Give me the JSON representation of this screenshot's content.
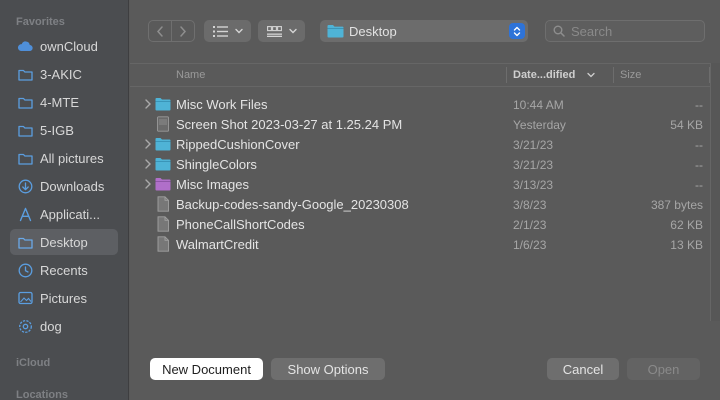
{
  "sidebar": {
    "sections": [
      {
        "title": "Favorites"
      },
      {
        "title": "iCloud"
      },
      {
        "title": "Locations"
      }
    ],
    "items": [
      {
        "label": "ownCloud",
        "icon": "cloud-icon"
      },
      {
        "label": "3-AKIC",
        "icon": "folder-icon"
      },
      {
        "label": "4-MTE",
        "icon": "folder-icon"
      },
      {
        "label": "5-IGB",
        "icon": "folder-icon"
      },
      {
        "label": "All pictures",
        "icon": "folder-icon"
      },
      {
        "label": "Downloads",
        "icon": "download-icon"
      },
      {
        "label": "Applicati...",
        "icon": "applications-icon"
      },
      {
        "label": "Desktop",
        "icon": "desktop-icon",
        "selected": true
      },
      {
        "label": "Recents",
        "icon": "clock-icon"
      },
      {
        "label": "Pictures",
        "icon": "photos-icon"
      },
      {
        "label": "dog",
        "icon": "gear-icon"
      }
    ]
  },
  "toolbar": {
    "location": "Desktop",
    "search_placeholder": "Search"
  },
  "columns": {
    "name": "Name",
    "date": "Date...dified",
    "size": "Size"
  },
  "files": [
    {
      "name": "Misc Work Files",
      "date": "10:44 AM",
      "size": "--",
      "type": "folder",
      "color": "#4fb3d6"
    },
    {
      "name": "Screen Shot 2023-03-27 at 1.25.24 PM",
      "date": "Yesterday",
      "size": "54 KB",
      "type": "image"
    },
    {
      "name": "RippedCushionCover",
      "date": "3/21/23",
      "size": "--",
      "type": "folder",
      "color": "#4fb3d6"
    },
    {
      "name": "ShingleColors",
      "date": "3/21/23",
      "size": "--",
      "type": "folder",
      "color": "#4fb3d6"
    },
    {
      "name": "Misc Images",
      "date": "3/13/23",
      "size": "--",
      "type": "folder",
      "color": "#b06fc9"
    },
    {
      "name": "Backup-codes-sandy-Google_20230308",
      "date": "3/8/23",
      "size": "387 bytes",
      "type": "document"
    },
    {
      "name": "PhoneCallShortCodes",
      "date": "2/1/23",
      "size": "62 KB",
      "type": "document"
    },
    {
      "name": "WalmartCredit",
      "date": "1/6/23",
      "size": "13 KB",
      "type": "document"
    }
  ],
  "bottombar": {
    "new_document": "New Document",
    "show_options": "Show Options",
    "cancel": "Cancel",
    "open": "Open"
  },
  "colors": {
    "accent": "#2e73d8",
    "folder_blue": "#4fb3d6",
    "folder_purple": "#b06fc9"
  }
}
